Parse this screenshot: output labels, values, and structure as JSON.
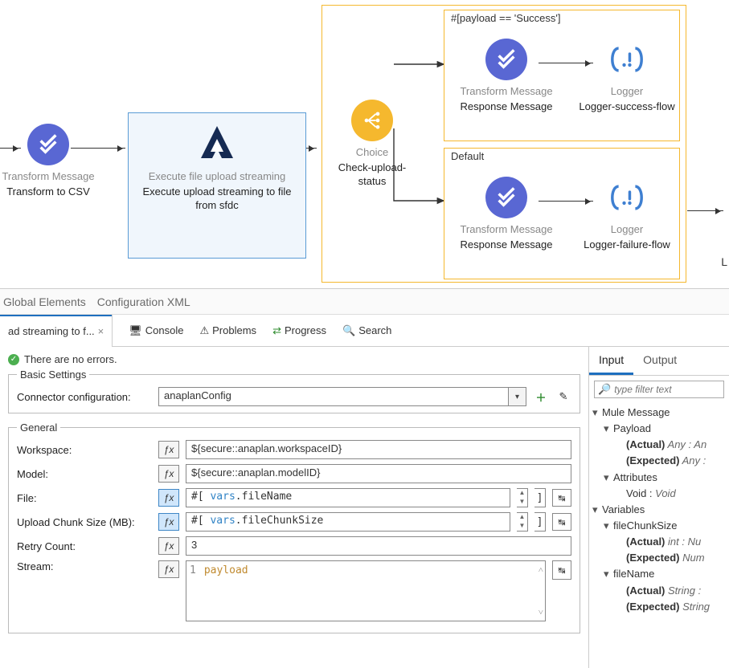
{
  "flow": {
    "transform1": {
      "title": "Transform Message",
      "label": "Transform to CSV"
    },
    "exec": {
      "title": "Execute file upload streaming",
      "label": "Execute upload streaming to file from sfdc"
    },
    "choice": {
      "title": "Choice",
      "label": "Check-upload-status"
    },
    "branchSuccess": {
      "condition": "#[payload == 'Success']",
      "transform": {
        "title": "Transform Message",
        "label": "Response Message"
      },
      "logger": {
        "title": "Logger",
        "label": "Logger-success-flow"
      }
    },
    "branchDefault": {
      "condition": "Default",
      "transform": {
        "title": "Transform Message",
        "label": "Response Message"
      },
      "logger": {
        "title": "Logger",
        "label": "Logger-failure-flow"
      }
    },
    "cutLabel": "L"
  },
  "topTabs": {
    "global": "Global Elements",
    "configXml": "Configuration XML"
  },
  "midTabs": {
    "active": "ad streaming to f...",
    "console": "Console",
    "problems": "Problems",
    "progress": "Progress",
    "search": "Search"
  },
  "status": "There are no errors.",
  "groups": {
    "basic": "Basic Settings",
    "general": "General"
  },
  "fields": {
    "connector": {
      "label": "Connector configuration:",
      "value": "anaplanConfig"
    },
    "workspace": {
      "label": "Workspace:",
      "value": "${secure::anaplan.workspaceID}"
    },
    "model": {
      "label": "Model:",
      "value": "${secure::anaplan.modelID}"
    },
    "file": {
      "label": "File:",
      "prefix": "#[ ",
      "var": "vars",
      "suffix": ".fileName"
    },
    "chunk": {
      "label": "Upload Chunk Size (MB):",
      "prefix": "#[ ",
      "var": "vars",
      "suffix": ".fileChunkSize"
    },
    "retry": {
      "label": "Retry Count:",
      "value": "3"
    },
    "stream": {
      "label": "Stream:",
      "lineNo": "1",
      "code": "payload"
    }
  },
  "io": {
    "tabs": {
      "input": "Input",
      "output": "Output"
    },
    "filterPlaceholder": "type filter text",
    "tree": {
      "muleMessage": "Mule Message",
      "payload": "Payload",
      "payloadActual": "(Actual)",
      "payloadActualVal": " Any : An",
      "payloadExpected": "(Expected)",
      "payloadExpectedVal": " Any :",
      "attributes": "Attributes",
      "attrVoid": "Void : ",
      "attrVoidI": "Void",
      "variables": "Variables",
      "fcs": "fileChunkSize",
      "fcsActual": "(Actual)",
      "fcsActualVal": " int : Nu",
      "fcsExpected": "(Expected)",
      "fcsExpectedVal": " Num",
      "fn": "fileName",
      "fnActual": "(Actual)",
      "fnActualVal": " String :",
      "fnExpected": "(Expected)",
      "fnExpectedVal": " String"
    }
  }
}
